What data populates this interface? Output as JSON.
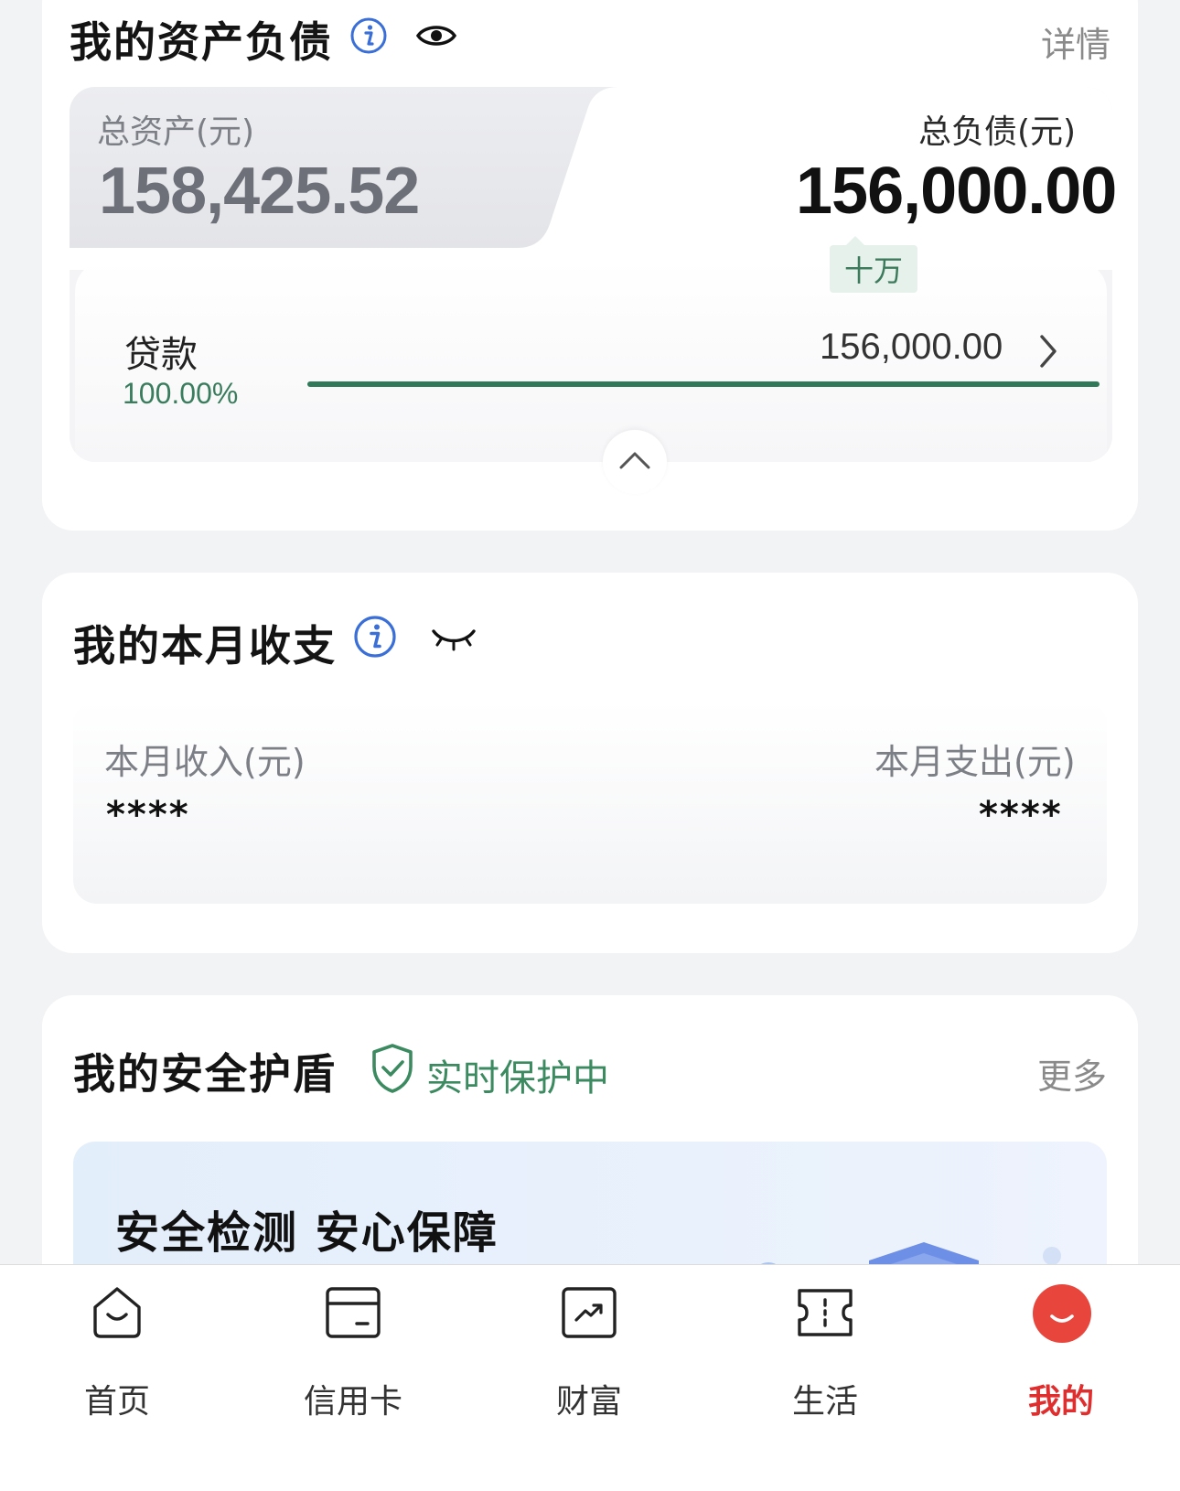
{
  "assets_card": {
    "title": "我的资产负债",
    "detail_link": "详情",
    "total_assets_label": "总资产(元)",
    "total_assets_value": "158,425.52",
    "total_liabilities_label": "总负债(元)",
    "total_liabilities_value": "156,000.00",
    "unit_badge": "十万",
    "loan": {
      "label": "贷款",
      "amount": "156,000.00",
      "percent_text": "100.00%",
      "fill_fraction": 1.0
    }
  },
  "month_card": {
    "title": "我的本月收支",
    "income_label": "本月收入(元)",
    "income_value": "****",
    "expense_label": "本月支出(元)",
    "expense_value": "****"
  },
  "security_card": {
    "title": "我的安全护盾",
    "status": "实时保护中",
    "more_link": "更多",
    "banner_title": "安全检测 安心保障"
  },
  "tabbar": {
    "items": [
      {
        "label": "首页",
        "icon": "home-icon"
      },
      {
        "label": "信用卡",
        "icon": "credit-card-icon"
      },
      {
        "label": "财富",
        "icon": "wealth-chart-icon"
      },
      {
        "label": "生活",
        "icon": "ticket-icon"
      },
      {
        "label": "我的",
        "icon": "profile-icon"
      }
    ],
    "active_index": 4
  },
  "colors": {
    "accent_green": "#2f7a58",
    "info_blue": "#3a6fd8",
    "active_red": "#e02e2e"
  }
}
